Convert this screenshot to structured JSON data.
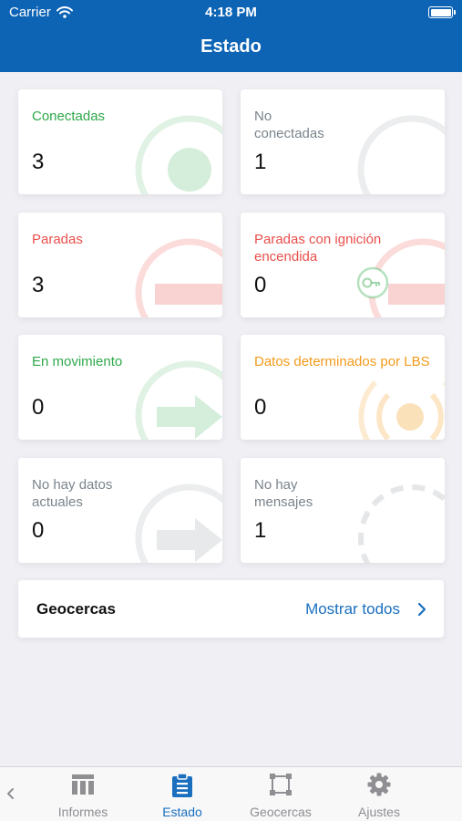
{
  "status_bar": {
    "carrier": "Carrier",
    "time": "4:18 PM"
  },
  "nav": {
    "title": "Estado"
  },
  "cards": [
    {
      "label": "Conectadas",
      "count": "3",
      "color": "#2ea84a",
      "icon": "connected-circle-icon"
    },
    {
      "label": "No conectadas",
      "count": "1",
      "color": "#7a848c",
      "icon": "disconnected-circle-icon"
    },
    {
      "label": "Paradas",
      "count": "3",
      "color": "#e94f4a",
      "icon": "stop-icon"
    },
    {
      "label": "Paradas con ignición encendida",
      "count": "0",
      "color": "#e94f4a",
      "icon": "key-stop-icon"
    },
    {
      "label": "En movimiento",
      "count": "0",
      "color": "#2ea84a",
      "icon": "moving-arrow-icon"
    },
    {
      "label": "Datos determinados por LBS",
      "count": "0",
      "color": "#f39a1a",
      "icon": "lbs-signal-icon"
    },
    {
      "label": "No hay datos actuales",
      "count": "0",
      "color": "#7a848c",
      "icon": "no-data-arrow-icon"
    },
    {
      "label": "No hay mensajes",
      "count": "1",
      "color": "#7a848c",
      "icon": "no-messages-dashed-icon"
    }
  ],
  "geofences": {
    "title": "Geocercas",
    "link": "Mostrar todos"
  },
  "tabs": [
    {
      "label": "Informes",
      "icon": "reports-table-icon"
    },
    {
      "label": "Estado",
      "icon": "status-clipboard-icon"
    },
    {
      "label": "Geocercas",
      "icon": "geofence-square-icon"
    },
    {
      "label": "Ajustes",
      "icon": "settings-gear-icon"
    }
  ],
  "colors": {
    "accent": "#1a6fbf",
    "header": "#0d64b5",
    "green": "#2ea84a",
    "red": "#e94f4a",
    "orange": "#f39a1a",
    "gray": "#7a848c"
  }
}
